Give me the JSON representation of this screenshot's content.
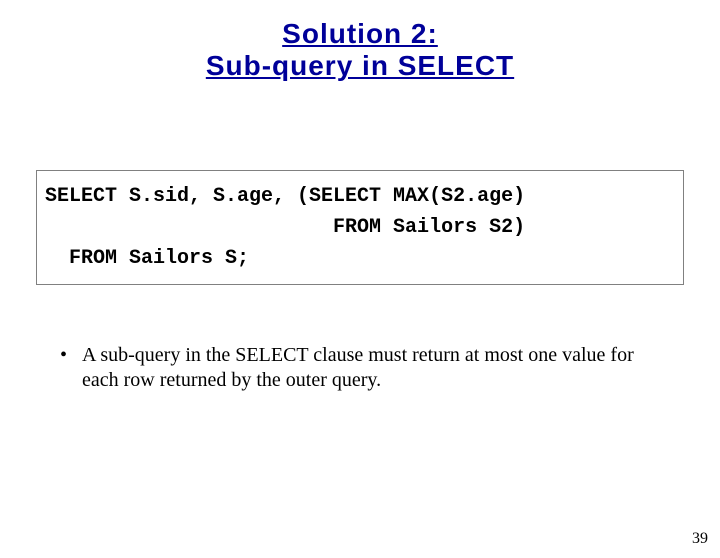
{
  "title": {
    "line1": "Solution 2:",
    "line2": "Sub-query in SELECT"
  },
  "code": {
    "line1": "SELECT S.sid, S.age, (SELECT MAX(S2.age)",
    "line2": "                        FROM Sailors S2)",
    "line3": "  FROM Sailors S;"
  },
  "bullet": {
    "dot": "•",
    "text": "A sub-query in the SELECT clause must return at most one value for each row returned by the outer query."
  },
  "page_number": "39"
}
